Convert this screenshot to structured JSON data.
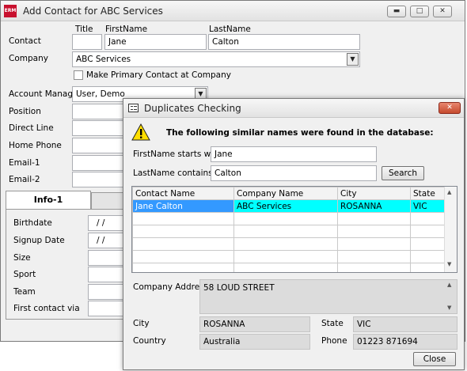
{
  "main_window": {
    "app_icon": "ERM",
    "title": "Add Contact for ABC Services",
    "col_headers": {
      "title": "Title",
      "firstname": "FirstName",
      "lastname": "LastName"
    },
    "contact_label": "Contact",
    "contact_title_value": "",
    "contact_firstname_value": "Jane",
    "contact_lastname_value": "Calton",
    "company_label": "Company",
    "company_value": "ABC Services",
    "primary_contact_label": "Make Primary Contact at Company",
    "account_manager_label": "Account Manager",
    "account_manager_value": "User, Demo",
    "position_label": "Position",
    "direct_line_label": "Direct Line",
    "home_phone_label": "Home Phone",
    "email1_label": "Email-1",
    "email2_label": "Email-2",
    "tab_info1": "Info-1",
    "birthdate_label": "Birthdate",
    "birthdate_value": "/ /",
    "signup_label": "Signup Date",
    "signup_value": "/ /",
    "size_label": "Size",
    "sport_label": "Sport",
    "team_label": "Team",
    "first_contact_label": "First contact via"
  },
  "dialog": {
    "title": "Duplicates Checking",
    "message": "The following similar names were found in the database:",
    "firstname_label": "FirstName starts with",
    "firstname_value": "Jane",
    "lastname_label": "LastName contains",
    "lastname_value": "Calton",
    "search_button": "Search",
    "table": {
      "headers": [
        "Contact Name",
        "Company Name",
        "City",
        "State"
      ],
      "rows": [
        [
          "Jane Calton",
          "ABC Services",
          "ROSANNA",
          "VIC"
        ]
      ]
    },
    "company_address_label": "Company Address",
    "company_address_value": "58 LOUD STREET",
    "city_label": "City",
    "city_value": "ROSANNA",
    "state_label": "State",
    "state_value": "VIC",
    "country_label": "Country",
    "country_value": "Australia",
    "phone_label": "Phone",
    "phone_value": "01223 871694",
    "close_button": "Close"
  }
}
